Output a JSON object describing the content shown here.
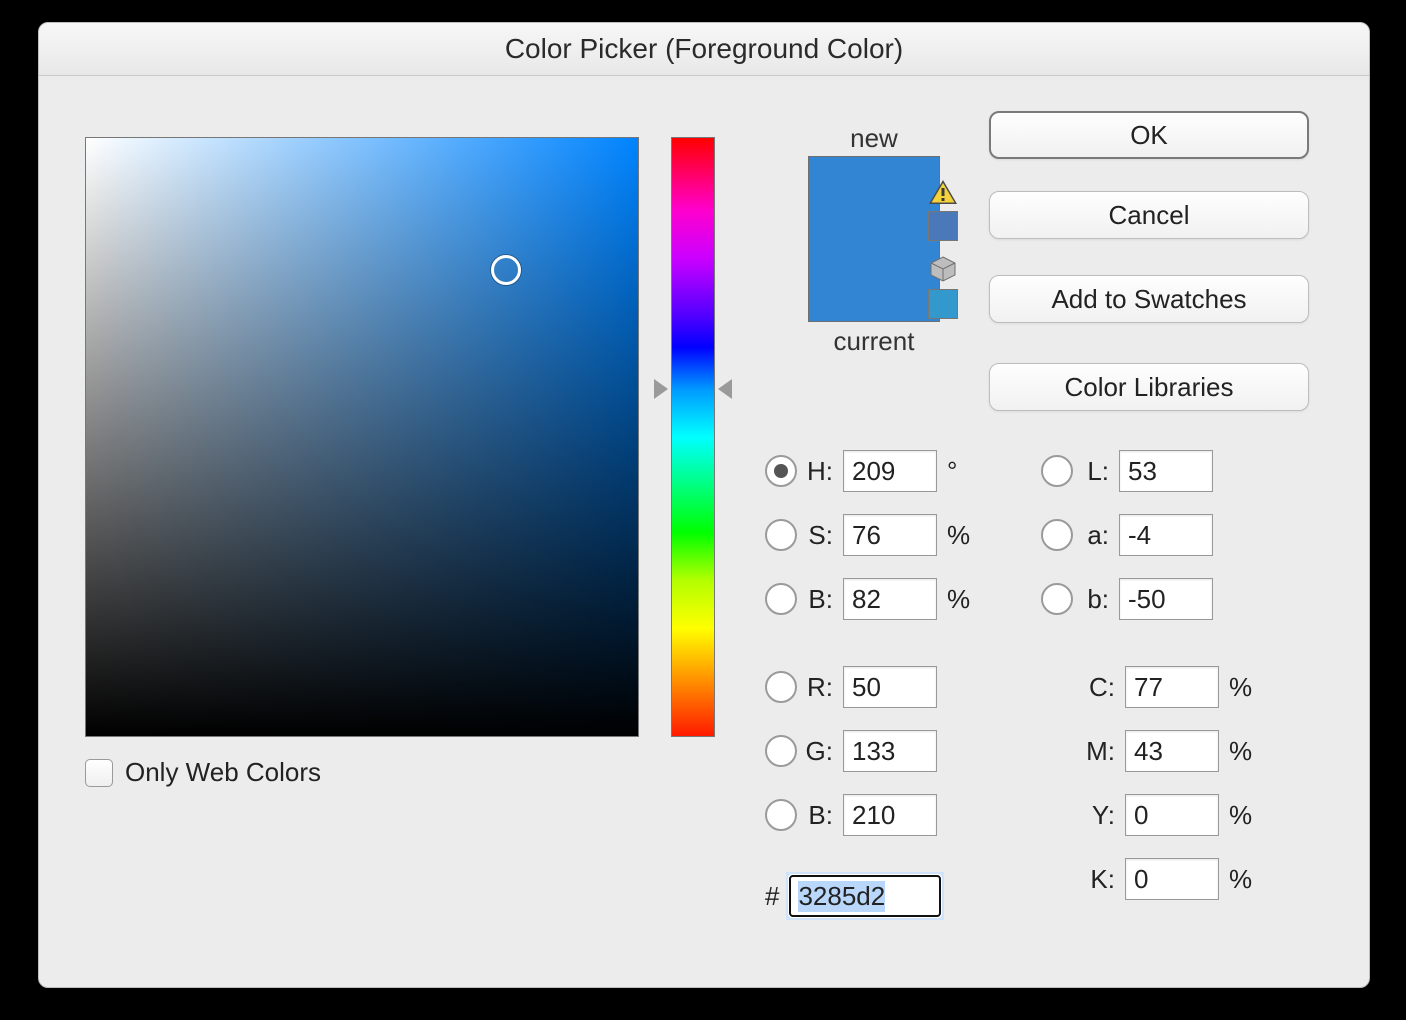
{
  "dialog": {
    "title": "Color Picker (Foreground Color)"
  },
  "buttons": {
    "ok": "OK",
    "cancel": "Cancel",
    "add_swatches": "Add to Swatches",
    "color_libraries": "Color Libraries"
  },
  "preview": {
    "new_label": "new",
    "current_label": "current",
    "new_color": "#3285d2",
    "current_color": "#3285d2",
    "warn_swatch": "#4a78b9",
    "websafe_swatch": "#3399cc"
  },
  "selected": {
    "hex": "3285d2",
    "hue_fraction_top": 0.42,
    "field_x": 0.76,
    "field_y": 0.22
  },
  "hsb": {
    "h_label": "H:",
    "s_label": "S:",
    "b_label": "B:",
    "h": "209",
    "s": "76",
    "b": "82",
    "h_unit": "°",
    "pct": "%",
    "selected_radio": "H"
  },
  "rgb": {
    "r_label": "R:",
    "g_label": "G:",
    "b_label": "B:",
    "r": "50",
    "g": "133",
    "b": "210"
  },
  "lab": {
    "l_label": "L:",
    "a_label": "a:",
    "b_label": "b:",
    "l": "53",
    "a": "-4",
    "b2": "-50"
  },
  "cmyk": {
    "c_label": "C:",
    "m_label": "M:",
    "y_label": "Y:",
    "k_label": "K:",
    "c": "77",
    "m": "43",
    "y": "0",
    "k": "0",
    "pct": "%"
  },
  "only_web_label": "Only Web Colors",
  "hex_prefix": "#"
}
